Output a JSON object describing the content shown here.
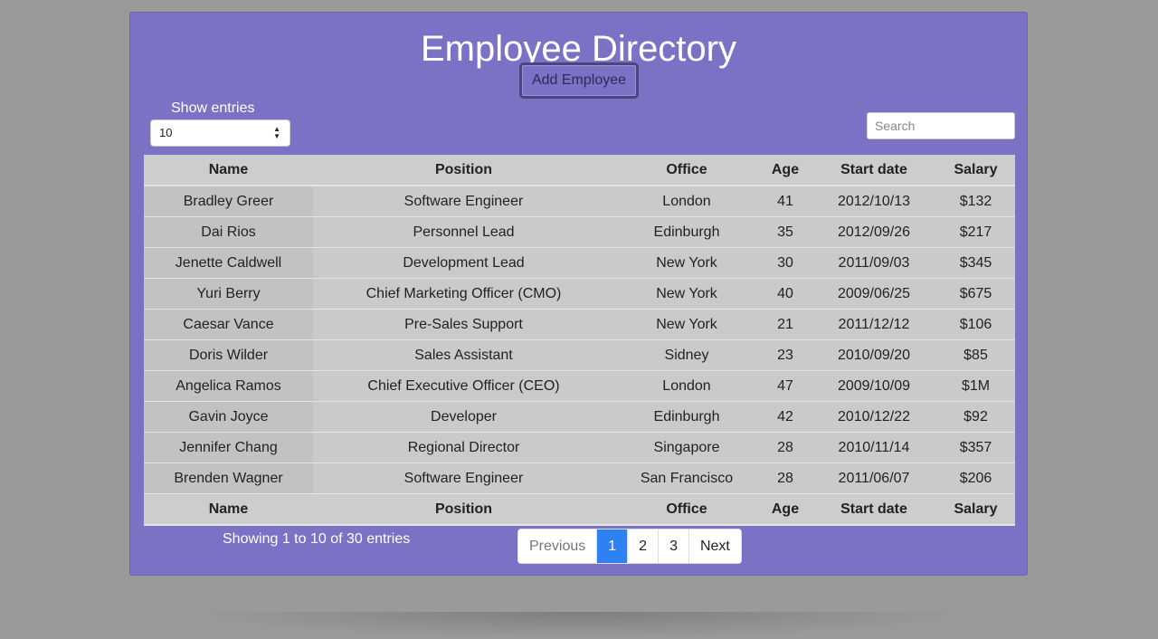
{
  "page": {
    "title": "Employee Directory"
  },
  "toolbar": {
    "add_label": "Add Employee"
  },
  "length": {
    "label": "Show entries",
    "value": "10"
  },
  "search": {
    "placeholder": "Search"
  },
  "table": {
    "headers": [
      "Name",
      "Position",
      "Office",
      "Age",
      "Start date",
      "Salary"
    ],
    "rows": [
      [
        "Bradley Greer",
        "Software Engineer",
        "London",
        "41",
        "2012/10/13",
        "$132"
      ],
      [
        "Dai Rios",
        "Personnel Lead",
        "Edinburgh",
        "35",
        "2012/09/26",
        "$217"
      ],
      [
        "Jenette Caldwell",
        "Development Lead",
        "New York",
        "30",
        "2011/09/03",
        "$345"
      ],
      [
        "Yuri Berry",
        "Chief Marketing Officer (CMO)",
        "New York",
        "40",
        "2009/06/25",
        "$675"
      ],
      [
        "Caesar Vance",
        "Pre-Sales Support",
        "New York",
        "21",
        "2011/12/12",
        "$106"
      ],
      [
        "Doris Wilder",
        "Sales Assistant",
        "Sidney",
        "23",
        "2010/09/20",
        "$85"
      ],
      [
        "Angelica Ramos",
        "Chief Executive Officer (CEO)",
        "London",
        "47",
        "2009/10/09",
        "$1M"
      ],
      [
        "Gavin Joyce",
        "Developer",
        "Edinburgh",
        "42",
        "2010/12/22",
        "$92"
      ],
      [
        "Jennifer Chang",
        "Regional Director",
        "Singapore",
        "28",
        "2010/11/14",
        "$357"
      ],
      [
        "Brenden Wagner",
        "Software Engineer",
        "San Francisco",
        "28",
        "2011/06/07",
        "$206"
      ]
    ]
  },
  "info": "Showing 1 to 10 of 30 entries",
  "pagination": {
    "previous": "Previous",
    "pages": [
      "1",
      "2",
      "3"
    ],
    "next": "Next",
    "active": "1"
  },
  "colors": {
    "panel": "#7b72c6",
    "active_page": "#2f80f0"
  }
}
